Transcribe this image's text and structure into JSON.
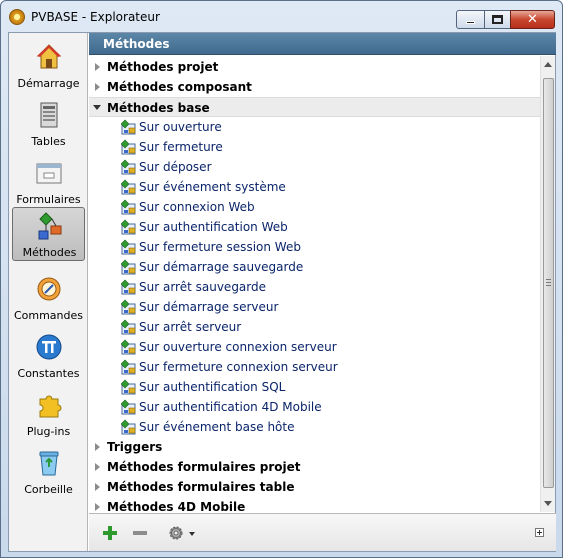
{
  "window": {
    "title": "PVBASE - Explorateur",
    "close_glyph": "✕"
  },
  "sidebar": {
    "items": [
      {
        "label": "Démarrage",
        "icon": "home-icon"
      },
      {
        "label": "Tables",
        "icon": "tables-icon"
      },
      {
        "label": "Formulaires",
        "icon": "forms-icon"
      },
      {
        "label": "Méthodes",
        "icon": "methods-icon",
        "active": true
      },
      {
        "label": "Commandes",
        "icon": "commands-icon"
      },
      {
        "label": "Constantes",
        "icon": "pi-icon"
      },
      {
        "label": "Plug-ins",
        "icon": "puzzle-icon"
      },
      {
        "label": "Corbeille",
        "icon": "trash-icon"
      }
    ]
  },
  "panel": {
    "header": "Méthodes",
    "groups_top": [
      "Méthodes projet",
      "Méthodes composant",
      "Méthodes base"
    ],
    "database_methods": [
      "Sur ouverture",
      "Sur fermeture",
      "Sur déposer",
      "Sur événement système",
      "Sur connexion Web",
      "Sur authentification Web",
      "Sur fermeture session Web",
      "Sur démarrage sauvegarde",
      "Sur arrêt sauvegarde",
      "Sur démarrage serveur",
      "Sur arrêt serveur",
      "Sur ouverture connexion serveur",
      "Sur fermeture connexion serveur",
      "Sur authentification SQL",
      "Sur authentification 4D Mobile",
      "Sur événement base hôte"
    ],
    "groups_bottom": [
      "Triggers",
      "Méthodes formulaires projet",
      "Méthodes formulaires table",
      "Méthodes 4D Mobile"
    ]
  },
  "colors": {
    "header_bg": "#4a7598",
    "method_text": "#0a246a",
    "add_green": "#2e9a2e"
  }
}
